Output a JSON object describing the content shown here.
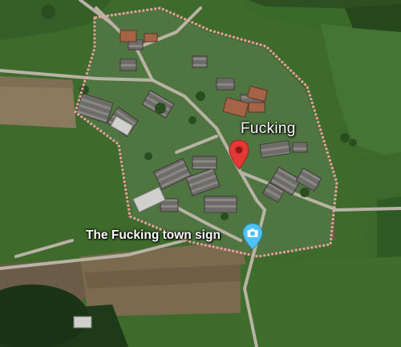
{
  "map": {
    "view": "satellite",
    "boundary_color": "#e8a0a0",
    "place": {
      "label": "Fucking",
      "pin_color": "#e53935",
      "icon": "location-pin-icon"
    },
    "poi": {
      "label": "The Fucking town sign",
      "marker_color": "#4fc3f7",
      "icon": "camera-icon"
    }
  }
}
